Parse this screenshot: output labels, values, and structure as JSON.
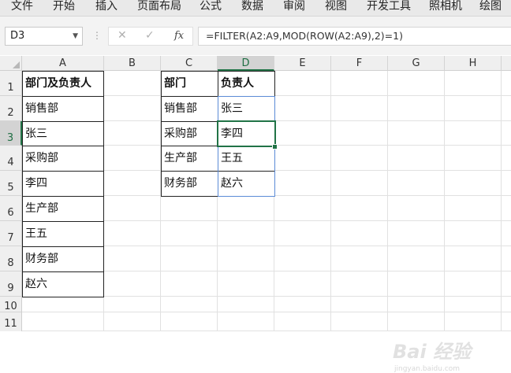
{
  "ribbon": {
    "tabs": [
      "文件",
      "开始",
      "插入",
      "页面布局",
      "公式",
      "数据",
      "审阅",
      "视图",
      "开发工具",
      "照相机",
      "绘图"
    ]
  },
  "formula_bar": {
    "name_box": "D3",
    "cancel_icon": "close-icon",
    "enter_icon": "check-icon",
    "fx_label": "fx",
    "formula": "=FILTER(A2:A9,MOD(ROW(A2:A9),2)=1)"
  },
  "sheet": {
    "columns": [
      "A",
      "B",
      "C",
      "D",
      "E",
      "F",
      "G",
      "H"
    ],
    "rows": [
      "1",
      "2",
      "3",
      "4",
      "5",
      "6",
      "7",
      "8",
      "9",
      "10",
      "11"
    ],
    "selected_cell": "D3",
    "column_a": {
      "header": "部门及负责人",
      "values": [
        "销售部",
        "张三",
        "采购部",
        "李四",
        "生产部",
        "王五",
        "财务部",
        "赵六"
      ]
    },
    "result_table": {
      "headers": [
        "部门",
        "负责人"
      ],
      "rows": [
        [
          "销售部",
          "张三"
        ],
        [
          "采购部",
          "李四"
        ],
        [
          "生产部",
          "王五"
        ],
        [
          "财务部",
          "赵六"
        ]
      ]
    }
  },
  "watermark": {
    "text": "Bai 经验",
    "url": "jingyan.baidu.com"
  },
  "colors": {
    "accent": "#217346",
    "spill_border": "#5b8bd6"
  }
}
